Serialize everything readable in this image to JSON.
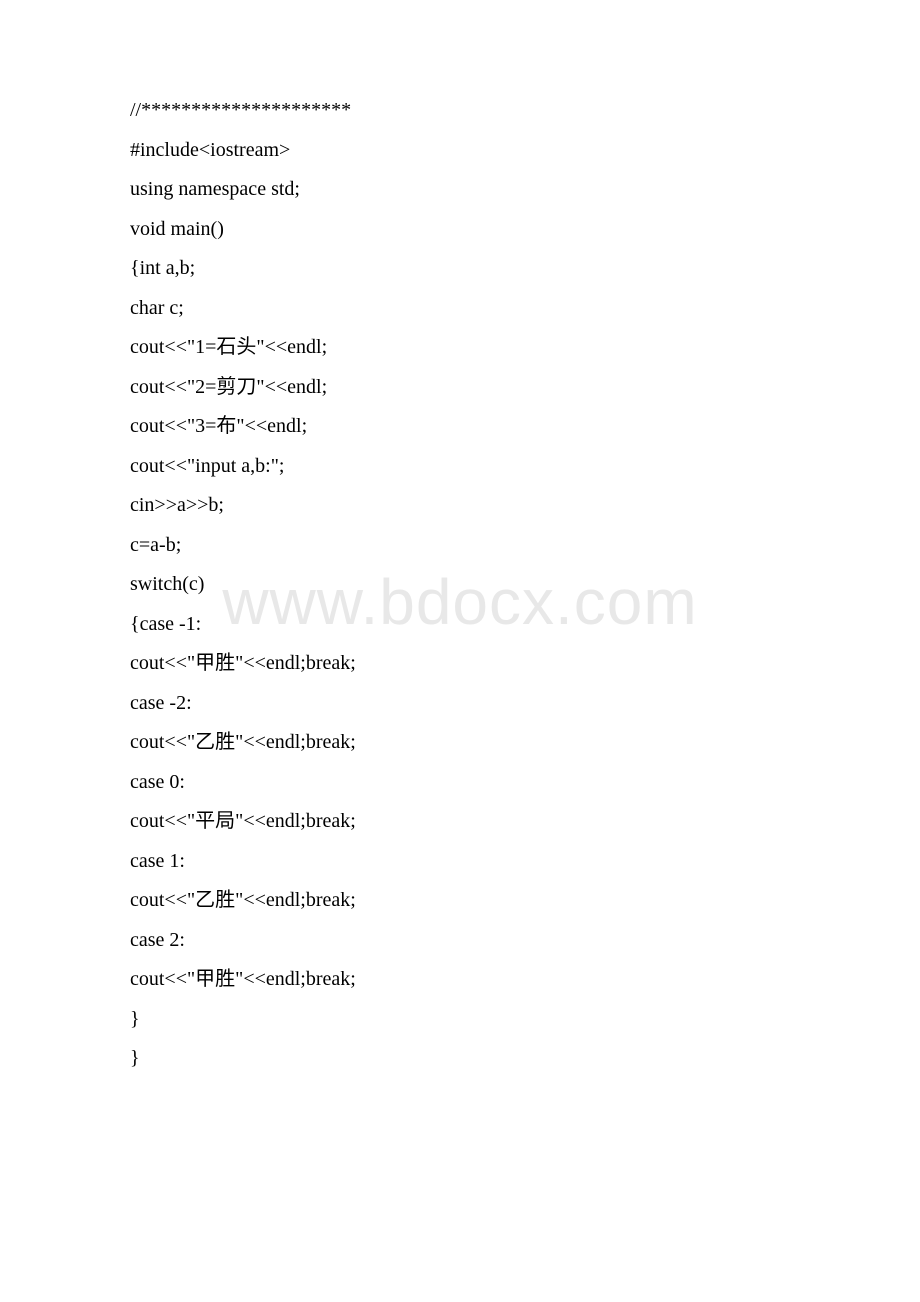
{
  "watermark": "www.bdocx.com",
  "code": {
    "lines": [
      "//*********************",
      "#include<iostream>",
      "using  namespace std;",
      "void  main()",
      "{int a,b;",
      "char c;",
      "cout<<\"1=石头\"<<endl;",
      "cout<<\"2=剪刀\"<<endl;",
      "cout<<\"3=布\"<<endl;",
      "cout<<\"input a,b:\";",
      "cin>>a>>b;",
      "c=a-b;",
      "switch(c)",
      "{case -1:",
      "cout<<\"甲胜\"<<endl;break;",
      "case -2:",
      "cout<<\"乙胜\"<<endl;break;",
      "case 0:",
      "cout<<\"平局\"<<endl;break;",
      "case 1:",
      "cout<<\"乙胜\"<<endl;break;",
      "case 2:",
      "cout<<\"甲胜\"<<endl;break;",
      "}",
      "}"
    ]
  }
}
